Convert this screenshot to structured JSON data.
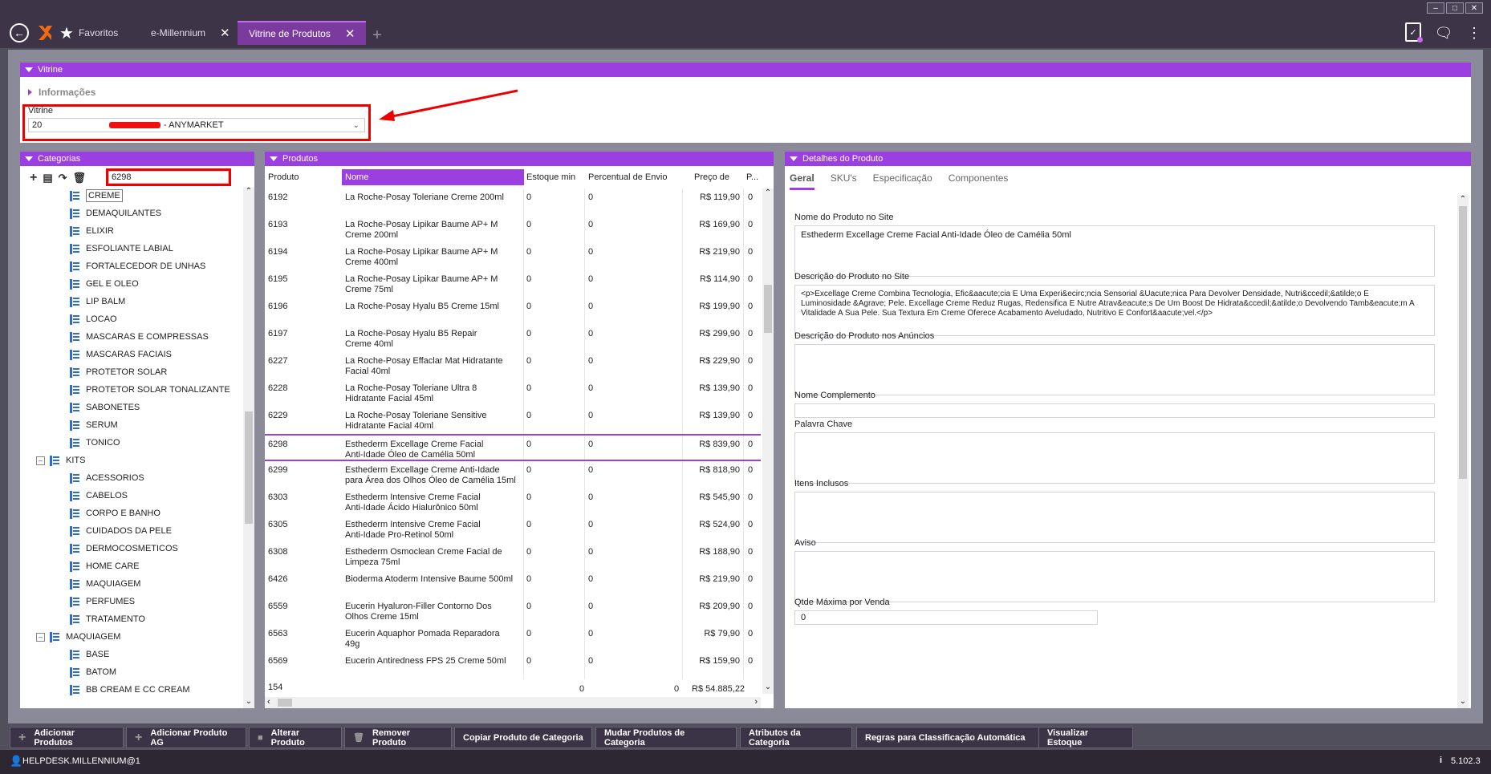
{
  "tabs": {
    "favorites": "Favoritos",
    "emillennium": "e-Millennium",
    "vitrine": "Vitrine de Produtos"
  },
  "vitrine": {
    "header": "Vitrine",
    "info": "Informações",
    "field_label": "Vitrine",
    "code": "20",
    "name": "- ANYMARKET"
  },
  "categorias": {
    "header": "Categorias",
    "search": "6298",
    "tooltip": "CREME",
    "items": [
      "DEMAQUILANTES",
      "ELIXIR",
      "ESFOLIANTE LABIAL",
      "FORTALECEDOR DE UNHAS",
      "GEL E OLEO",
      "LIP BALM",
      "LOCAO",
      "MASCARAS E COMPRESSAS",
      "MASCARAS FACIAIS",
      "PROTETOR SOLAR",
      "PROTETOR SOLAR TONALIZANTE",
      "SABONETES",
      "SERUM",
      "TONICO"
    ],
    "kits": "KITS",
    "kits_items": [
      "ACESSORIOS",
      "CABELOS",
      "CORPO E BANHO",
      "CUIDADOS DA PELE",
      "DERMOCOSMETICOS",
      "HOME CARE",
      "MAQUIAGEM",
      "PERFUMES",
      "TRATAMENTO"
    ],
    "maquiagem": "MAQUIAGEM",
    "maquiagem_items": [
      "BASE",
      "BATOM",
      "BB CREAM E CC CREAM"
    ]
  },
  "produtos": {
    "header": "Produtos",
    "columns": [
      "Produto",
      "Nome",
      "Estoque min",
      "Percentual de Envio",
      "Preço de",
      "P..."
    ],
    "rows": [
      {
        "id": "6192",
        "name": [
          "La Roche-Posay Toleriane Creme 200ml",
          ""
        ],
        "est": "0",
        "pct": "0",
        "price": "R$ 119,90",
        "p": "0"
      },
      {
        "id": "6193",
        "name": [
          "La Roche-Posay Lipikar Baume AP+ M",
          "Creme 200ml"
        ],
        "est": "0",
        "pct": "0",
        "price": "R$ 169,90",
        "p": "0"
      },
      {
        "id": "6194",
        "name": [
          "La Roche-Posay Lipikar Baume AP+ M",
          "Creme 400ml"
        ],
        "est": "0",
        "pct": "0",
        "price": "R$ 219,90",
        "p": "0"
      },
      {
        "id": "6195",
        "name": [
          "La Roche-Posay Lipikar Baume AP+ M",
          "Creme 75ml"
        ],
        "est": "0",
        "pct": "0",
        "price": "R$ 114,90",
        "p": "0"
      },
      {
        "id": "6196",
        "name": [
          "La Roche-Posay Hyalu B5 Creme 15ml",
          ""
        ],
        "est": "0",
        "pct": "0",
        "price": "R$ 199,90",
        "p": "0"
      },
      {
        "id": "6197",
        "name": [
          "La Roche-Posay Hyalu B5 Repair",
          "Creme 40ml"
        ],
        "est": "0",
        "pct": "0",
        "price": "R$ 299,90",
        "p": "0"
      },
      {
        "id": "6227",
        "name": [
          "La Roche-Posay Effaclar Mat Hidratante",
          "Facial 40ml"
        ],
        "est": "0",
        "pct": "0",
        "price": "R$ 229,90",
        "p": "0"
      },
      {
        "id": "6228",
        "name": [
          "La Roche-Posay Toleriane Ultra 8",
          "Hidratante Facial 45ml"
        ],
        "est": "0",
        "pct": "0",
        "price": "R$ 139,90",
        "p": "0"
      },
      {
        "id": "6229",
        "name": [
          "La Roche-Posay Toleriane Sensitive",
          "Hidratante Facial 40ml"
        ],
        "est": "0",
        "pct": "0",
        "price": "R$ 139,90",
        "p": "0"
      },
      {
        "id": "6298",
        "name": [
          "Esthederm Excellage Creme Facial",
          "Anti-Idade Óleo de Camélia 50ml"
        ],
        "est": "0",
        "pct": "0",
        "price": "R$ 839,90",
        "p": "0"
      },
      {
        "id": "6299",
        "name": [
          "Esthederm Excellage Creme Anti-Idade",
          "para Área dos Olhos Óleo de Camélia 15ml"
        ],
        "est": "0",
        "pct": "0",
        "price": "R$ 818,90",
        "p": "0"
      },
      {
        "id": "6303",
        "name": [
          "Esthederm Intensive Creme Facial",
          "Anti-Idade Ácido Hialurônico 50ml"
        ],
        "est": "0",
        "pct": "0",
        "price": "R$ 545,90",
        "p": "0"
      },
      {
        "id": "6305",
        "name": [
          "Esthederm Intensive Creme Facial",
          "Anti-Idade Pro-Retinol 50ml"
        ],
        "est": "0",
        "pct": "0",
        "price": "R$ 524,90",
        "p": "0"
      },
      {
        "id": "6308",
        "name": [
          "Esthederm Osmoclean Creme Facial de",
          "Limpeza 75ml"
        ],
        "est": "0",
        "pct": "0",
        "price": "R$ 188,90",
        "p": "0"
      },
      {
        "id": "6426",
        "name": [
          "Bioderma Atoderm Intensive Baume 500ml",
          ""
        ],
        "est": "0",
        "pct": "0",
        "price": "R$ 219,90",
        "p": "0"
      },
      {
        "id": "6559",
        "name": [
          "Eucerin Hyaluron-Filler Contorno Dos",
          "Olhos Creme 15ml"
        ],
        "est": "0",
        "pct": "0",
        "price": "R$ 209,90",
        "p": "0"
      },
      {
        "id": "6563",
        "name": [
          "Eucerin Aquaphor Pomada Reparadora",
          "49g"
        ],
        "est": "0",
        "pct": "0",
        "price": "R$ 79,90",
        "p": "0"
      },
      {
        "id": "6569",
        "name": [
          "Eucerin Antiredness FPS 25 Creme 50ml",
          ""
        ],
        "est": "0",
        "pct": "0",
        "price": "R$ 159,90",
        "p": "0"
      }
    ],
    "footer": {
      "count": "154",
      "est": "0",
      "pct": "0",
      "price": "R$ 54.885,22"
    }
  },
  "detalhes": {
    "header": "Detalhes do Produto",
    "tabs": [
      "Geral",
      "SKU's",
      "Especificação",
      "Componentes"
    ],
    "nome_label": "Nome do Produto no Site",
    "nome_value": "Esthederm Excellage Creme Facial Anti-Idade Óleo de Camélia 50ml",
    "desc_label": "Descrição do Produto no Site",
    "desc_value": "<p>Excellage Creme Combina Tecnologia, Efic&aacute;cia E Uma Experi&ecirc;ncia Sensorial &Uacute;nica Para Devolver Densidade, Nutri&ccedil;&atilde;o E Luminosidade &Agrave; Pele. Excellage Creme Reduz Rugas, Redensifica E Nutre Atrav&eacute;s De Um Boost De Hidrata&ccedil;&atilde;o Devolvendo Tamb&eacute;m A Vitalidade A Sua Pele. Sua Textura Em Creme Oferece Acabamento Aveludado, Nutritivo E Confort&aacute;vel.</p>",
    "anuncios_label": "Descrição do Produto nos Anúncios",
    "complemento_label": "Nome Complemento",
    "palavra_label": "Palavra Chave",
    "itens_label": "Itens Inclusos",
    "aviso_label": "Aviso",
    "qtde_label": "Qtde Máxima por Venda",
    "qtde_value": "0"
  },
  "buttons": [
    "Adicionar Produtos",
    "Adicionar Produto AG",
    "Alterar Produto",
    "Remover Produto",
    "Copiar Produto de Categoria",
    "Mudar Produtos de Categoria",
    "Atributos da Categoria",
    "Regras para Classificação Automática",
    "Visualizar Estoque"
  ],
  "status": {
    "user": "HELPDESK.MILLENNIUM@1",
    "version": "5.102.3"
  },
  "colors": {
    "accent": "#9b3fe0",
    "highlight": "#ec0000",
    "header_bg": "#3d3448"
  }
}
